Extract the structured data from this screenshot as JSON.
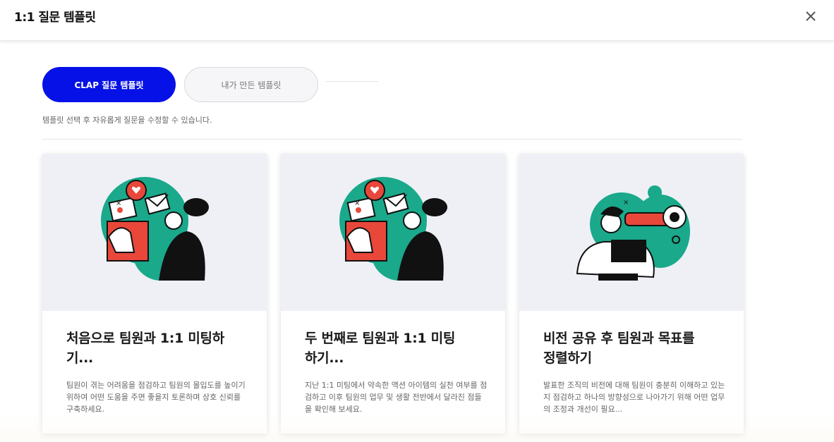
{
  "modal": {
    "title": "1:1 질문 템플릿",
    "close_icon": "close-icon"
  },
  "tabs": [
    {
      "label": "CLAP 질문 템플릿",
      "active": true
    },
    {
      "label": "내가 만든 템플릿",
      "active": false
    }
  ],
  "hint": "템플릿 선택 후 자유롭게 질문을 수정할 수 있습니다.",
  "colors": {
    "accent": "#0511e6",
    "teal": "#1aa98a",
    "red": "#e8473a",
    "card_image_bg": "#eef0f6"
  },
  "cards": [
    {
      "title_line1": "처음으로 팀원과 1:1 미팅하",
      "title_line2": "기...",
      "description": "팀원이 겪는 어려움을 점검하고 팀원의 몰입도를 높이기 위하여 어떤 도움을 주면 좋을지 토론하며 상호 신뢰를 구축하세요.",
      "illustration": "person-with-mail-heart-illustration"
    },
    {
      "title_line1": "두 번째로 팀원과 1:1 미팅",
      "title_line2": "하기...",
      "description": "지난 1:1 미팅에서 약속한 액션 아이템의 실천 여부를 점검하고 이후 팀원의 업무 및 생활 전반에서 달라진 점들을 확인해 보세요.",
      "illustration": "person-with-mail-heart-illustration"
    },
    {
      "title_line1": "비전 공유 후 팀원과 목표를",
      "title_line2": "정렬하기",
      "description": "발표한 조직의 비전에 대해 팀원이 충분히 이해하고 있는지 점검하고 하나의 방향성으로 나아가기 위해 어떤 업무의 조정과 개선이 필요...",
      "illustration": "person-with-telescope-illustration"
    }
  ]
}
